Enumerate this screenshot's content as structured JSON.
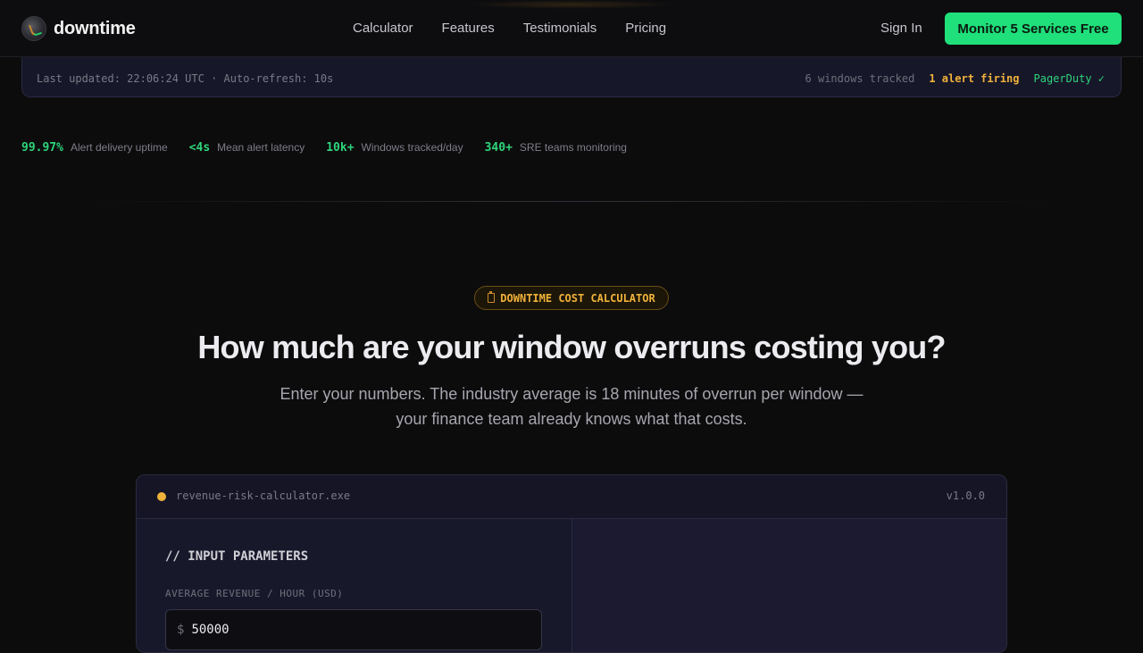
{
  "nav": {
    "brand": "downtime",
    "links": [
      "Calculator",
      "Features",
      "Testimonials",
      "Pricing"
    ],
    "sign_in": "Sign In",
    "cta": "Monitor 5 Services Free"
  },
  "status": {
    "updated": "Last updated: 22:06:24 UTC · Auto-refresh: 10s",
    "windows": "6 windows tracked",
    "alert": "1 alert firing",
    "integration": "PagerDuty ✓"
  },
  "stats": [
    {
      "value": "99.97%",
      "label": "Alert delivery uptime"
    },
    {
      "value": "<4s",
      "label": "Mean alert latency"
    },
    {
      "value": "10k+",
      "label": "Windows tracked/day"
    },
    {
      "value": "340+",
      "label": "SRE teams monitoring"
    }
  ],
  "hero": {
    "badge": "DOWNTIME COST CALCULATOR",
    "title": "How much are your window overruns costing you?",
    "subtitle_line1": "Enter your numbers. The industry average is 18 minutes of overrun per window —",
    "subtitle_line2": "your finance team already knows what that costs."
  },
  "calculator": {
    "filename": "revenue-risk-calculator.exe",
    "version": "v1.0.0",
    "section_title": "// INPUT PARAMETERS",
    "revenue_label": "AVERAGE REVENUE / HOUR (USD)",
    "currency_prefix": "$",
    "revenue_value": "50000"
  },
  "colors": {
    "accent_green": "#1fe07a",
    "alert_amber": "#f0b23a",
    "background": "#0c0c0d",
    "panel": "#17172a"
  }
}
